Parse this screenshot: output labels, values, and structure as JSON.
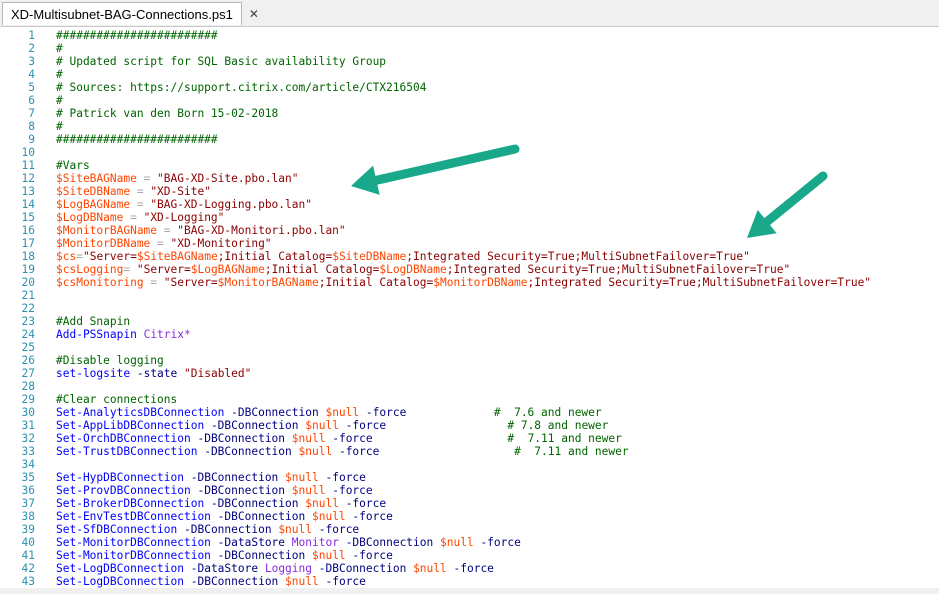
{
  "tab": {
    "title": "XD-Multisubnet-BAG-Connections.ps1",
    "close_glyph": "✕"
  },
  "annotation_color": "#1aa88a",
  "lines": [
    {
      "n": "1",
      "t": [
        [
          "cm",
          "########################"
        ]
      ]
    },
    {
      "n": "2",
      "t": [
        [
          "cm",
          "#"
        ]
      ]
    },
    {
      "n": "3",
      "t": [
        [
          "cm",
          "# Updated script for SQL Basic availability Group"
        ]
      ]
    },
    {
      "n": "4",
      "t": [
        [
          "cm",
          "#"
        ]
      ]
    },
    {
      "n": "5",
      "t": [
        [
          "cm",
          "# Sources: https://support.citrix.com/article/CTX216504"
        ]
      ]
    },
    {
      "n": "6",
      "t": [
        [
          "cm",
          "#"
        ]
      ]
    },
    {
      "n": "7",
      "t": [
        [
          "cm",
          "# Patrick van den Born 15-02-2018"
        ]
      ]
    },
    {
      "n": "8",
      "t": [
        [
          "cm",
          "#"
        ]
      ]
    },
    {
      "n": "9",
      "t": [
        [
          "cm",
          "########################"
        ]
      ]
    },
    {
      "n": "10",
      "t": []
    },
    {
      "n": "11",
      "t": [
        [
          "cm",
          "#Vars"
        ]
      ]
    },
    {
      "n": "12",
      "t": [
        [
          "var",
          "$SiteBAGName"
        ],
        [
          "op",
          " = "
        ],
        [
          "str",
          "\"BAG-XD-Site.pbo.lan\""
        ]
      ]
    },
    {
      "n": "13",
      "t": [
        [
          "var",
          "$SiteDBName"
        ],
        [
          "op",
          " = "
        ],
        [
          "str",
          "\"XD-Site\""
        ]
      ]
    },
    {
      "n": "14",
      "t": [
        [
          "var",
          "$LogBAGName"
        ],
        [
          "op",
          " = "
        ],
        [
          "str",
          "\"BAG-XD-Logging.pbo.lan\""
        ]
      ]
    },
    {
      "n": "15",
      "t": [
        [
          "var",
          "$LogDBName"
        ],
        [
          "op",
          " = "
        ],
        [
          "str",
          "\"XD-Logging\""
        ]
      ]
    },
    {
      "n": "16",
      "t": [
        [
          "var",
          "$MonitorBAGName"
        ],
        [
          "op",
          " = "
        ],
        [
          "str",
          "\"BAG-XD-Monitori.pbo.lan\""
        ]
      ]
    },
    {
      "n": "17",
      "t": [
        [
          "var",
          "$MonitorDBName"
        ],
        [
          "op",
          " = "
        ],
        [
          "str",
          "\"XD-Monitoring\""
        ]
      ]
    },
    {
      "n": "18",
      "t": [
        [
          "var",
          "$cs"
        ],
        [
          "op",
          "="
        ],
        [
          "str",
          "\"Server="
        ],
        [
          "var",
          "$SiteBAGName"
        ],
        [
          "str",
          ";Initial Catalog="
        ],
        [
          "var",
          "$SiteDBName"
        ],
        [
          "str",
          ";Integrated Security=True;MultiSubnetFailover=True\""
        ]
      ]
    },
    {
      "n": "19",
      "t": [
        [
          "var",
          "$csLogging"
        ],
        [
          "op",
          "= "
        ],
        [
          "str",
          "\"Server="
        ],
        [
          "var",
          "$LogBAGName"
        ],
        [
          "str",
          ";Initial Catalog="
        ],
        [
          "var",
          "$LogDBName"
        ],
        [
          "str",
          ";Integrated Security=True;MultiSubnetFailover=True\""
        ]
      ]
    },
    {
      "n": "20",
      "t": [
        [
          "var",
          "$csMonitoring"
        ],
        [
          "op",
          " = "
        ],
        [
          "str",
          "\"Server="
        ],
        [
          "var",
          "$MonitorBAGName"
        ],
        [
          "str",
          ";Initial Catalog="
        ],
        [
          "var",
          "$MonitorDBName"
        ],
        [
          "str",
          ";Integrated Security=True;MultiSubnetFailover=True\""
        ]
      ]
    },
    {
      "n": "21",
      "t": []
    },
    {
      "n": "22",
      "t": []
    },
    {
      "n": "23",
      "t": [
        [
          "cm",
          "#Add Snapin"
        ]
      ]
    },
    {
      "n": "24",
      "t": [
        [
          "cmd",
          "Add-PSSnapin"
        ],
        [
          "op",
          " "
        ],
        [
          "arg",
          "Citrix*"
        ]
      ]
    },
    {
      "n": "25",
      "t": []
    },
    {
      "n": "26",
      "t": [
        [
          "cm",
          "#Disable logging"
        ]
      ]
    },
    {
      "n": "27",
      "t": [
        [
          "cmd",
          "set-logsite"
        ],
        [
          "op",
          " "
        ],
        [
          "param",
          "-state"
        ],
        [
          "op",
          " "
        ],
        [
          "str",
          "\"Disabled\""
        ]
      ]
    },
    {
      "n": "28",
      "t": []
    },
    {
      "n": "29",
      "t": [
        [
          "cm",
          "#Clear connections"
        ]
      ]
    },
    {
      "n": "30",
      "t": [
        [
          "cmd",
          "Set-AnalyticsDBConnection"
        ],
        [
          "op",
          " "
        ],
        [
          "param",
          "-DBConnection"
        ],
        [
          "op",
          " "
        ],
        [
          "var",
          "$null"
        ],
        [
          "op",
          " "
        ],
        [
          "param",
          "-force"
        ],
        [
          "op",
          "             "
        ],
        [
          "cm",
          "#  7.6 and newer"
        ]
      ]
    },
    {
      "n": "31",
      "t": [
        [
          "cmd",
          "Set-AppLibDBConnection"
        ],
        [
          "op",
          " "
        ],
        [
          "param",
          "-DBConnection"
        ],
        [
          "op",
          " "
        ],
        [
          "var",
          "$null"
        ],
        [
          "op",
          " "
        ],
        [
          "param",
          "-force"
        ],
        [
          "op",
          "                  "
        ],
        [
          "cm",
          "# 7.8 and newer"
        ]
      ]
    },
    {
      "n": "32",
      "t": [
        [
          "cmd",
          "Set-OrchDBConnection"
        ],
        [
          "op",
          " "
        ],
        [
          "param",
          "-DBConnection"
        ],
        [
          "op",
          " "
        ],
        [
          "var",
          "$null"
        ],
        [
          "op",
          " "
        ],
        [
          "param",
          "-force"
        ],
        [
          "op",
          "                    "
        ],
        [
          "cm",
          "#  7.11 and newer"
        ]
      ]
    },
    {
      "n": "33",
      "t": [
        [
          "cmd",
          "Set-TrustDBConnection"
        ],
        [
          "op",
          " "
        ],
        [
          "param",
          "-DBConnection"
        ],
        [
          "op",
          " "
        ],
        [
          "var",
          "$null"
        ],
        [
          "op",
          " "
        ],
        [
          "param",
          "-force"
        ],
        [
          "op",
          "                    "
        ],
        [
          "cm",
          "#  7.11 and newer"
        ]
      ]
    },
    {
      "n": "34",
      "t": []
    },
    {
      "n": "35",
      "t": [
        [
          "cmd",
          "Set-HypDBConnection"
        ],
        [
          "op",
          " "
        ],
        [
          "param",
          "-DBConnection"
        ],
        [
          "op",
          " "
        ],
        [
          "var",
          "$null"
        ],
        [
          "op",
          " "
        ],
        [
          "param",
          "-force"
        ]
      ]
    },
    {
      "n": "36",
      "t": [
        [
          "cmd",
          "Set-ProvDBConnection"
        ],
        [
          "op",
          " "
        ],
        [
          "param",
          "-DBConnection"
        ],
        [
          "op",
          " "
        ],
        [
          "var",
          "$null"
        ],
        [
          "op",
          " "
        ],
        [
          "param",
          "-force"
        ]
      ]
    },
    {
      "n": "37",
      "t": [
        [
          "cmd",
          "Set-BrokerDBConnection"
        ],
        [
          "op",
          " "
        ],
        [
          "param",
          "-DBConnection"
        ],
        [
          "op",
          " "
        ],
        [
          "var",
          "$null"
        ],
        [
          "op",
          " "
        ],
        [
          "param",
          "-force"
        ]
      ]
    },
    {
      "n": "38",
      "t": [
        [
          "cmd",
          "Set-EnvTestDBConnection"
        ],
        [
          "op",
          " "
        ],
        [
          "param",
          "-DBConnection"
        ],
        [
          "op",
          " "
        ],
        [
          "var",
          "$null"
        ],
        [
          "op",
          " "
        ],
        [
          "param",
          "-force"
        ]
      ]
    },
    {
      "n": "39",
      "t": [
        [
          "cmd",
          "Set-SfDBConnection"
        ],
        [
          "op",
          " "
        ],
        [
          "param",
          "-DBConnection"
        ],
        [
          "op",
          " "
        ],
        [
          "var",
          "$null"
        ],
        [
          "op",
          " "
        ],
        [
          "param",
          "-force"
        ]
      ]
    },
    {
      "n": "40",
      "t": [
        [
          "cmd",
          "Set-MonitorDBConnection"
        ],
        [
          "op",
          " "
        ],
        [
          "param",
          "-DataStore"
        ],
        [
          "op",
          " "
        ],
        [
          "arg",
          "Monitor"
        ],
        [
          "op",
          " "
        ],
        [
          "param",
          "-DBConnection"
        ],
        [
          "op",
          " "
        ],
        [
          "var",
          "$null"
        ],
        [
          "op",
          " "
        ],
        [
          "param",
          "-force"
        ]
      ]
    },
    {
      "n": "41",
      "t": [
        [
          "cmd",
          "Set-MonitorDBConnection"
        ],
        [
          "op",
          " "
        ],
        [
          "param",
          "-DBConnection"
        ],
        [
          "op",
          " "
        ],
        [
          "var",
          "$null"
        ],
        [
          "op",
          " "
        ],
        [
          "param",
          "-force"
        ]
      ]
    },
    {
      "n": "42",
      "t": [
        [
          "cmd",
          "Set-LogDBConnection"
        ],
        [
          "op",
          " "
        ],
        [
          "param",
          "-DataStore"
        ],
        [
          "op",
          " "
        ],
        [
          "arg",
          "Logging"
        ],
        [
          "op",
          " "
        ],
        [
          "param",
          "-DBConnection"
        ],
        [
          "op",
          " "
        ],
        [
          "var",
          "$null"
        ],
        [
          "op",
          " "
        ],
        [
          "param",
          "-force"
        ]
      ]
    },
    {
      "n": "43",
      "t": [
        [
          "cmd",
          "Set-LogDBConnection"
        ],
        [
          "op",
          " "
        ],
        [
          "param",
          "-DBConnection"
        ],
        [
          "op",
          " "
        ],
        [
          "var",
          "$null"
        ],
        [
          "op",
          " "
        ],
        [
          "param",
          "-force"
        ]
      ]
    }
  ]
}
